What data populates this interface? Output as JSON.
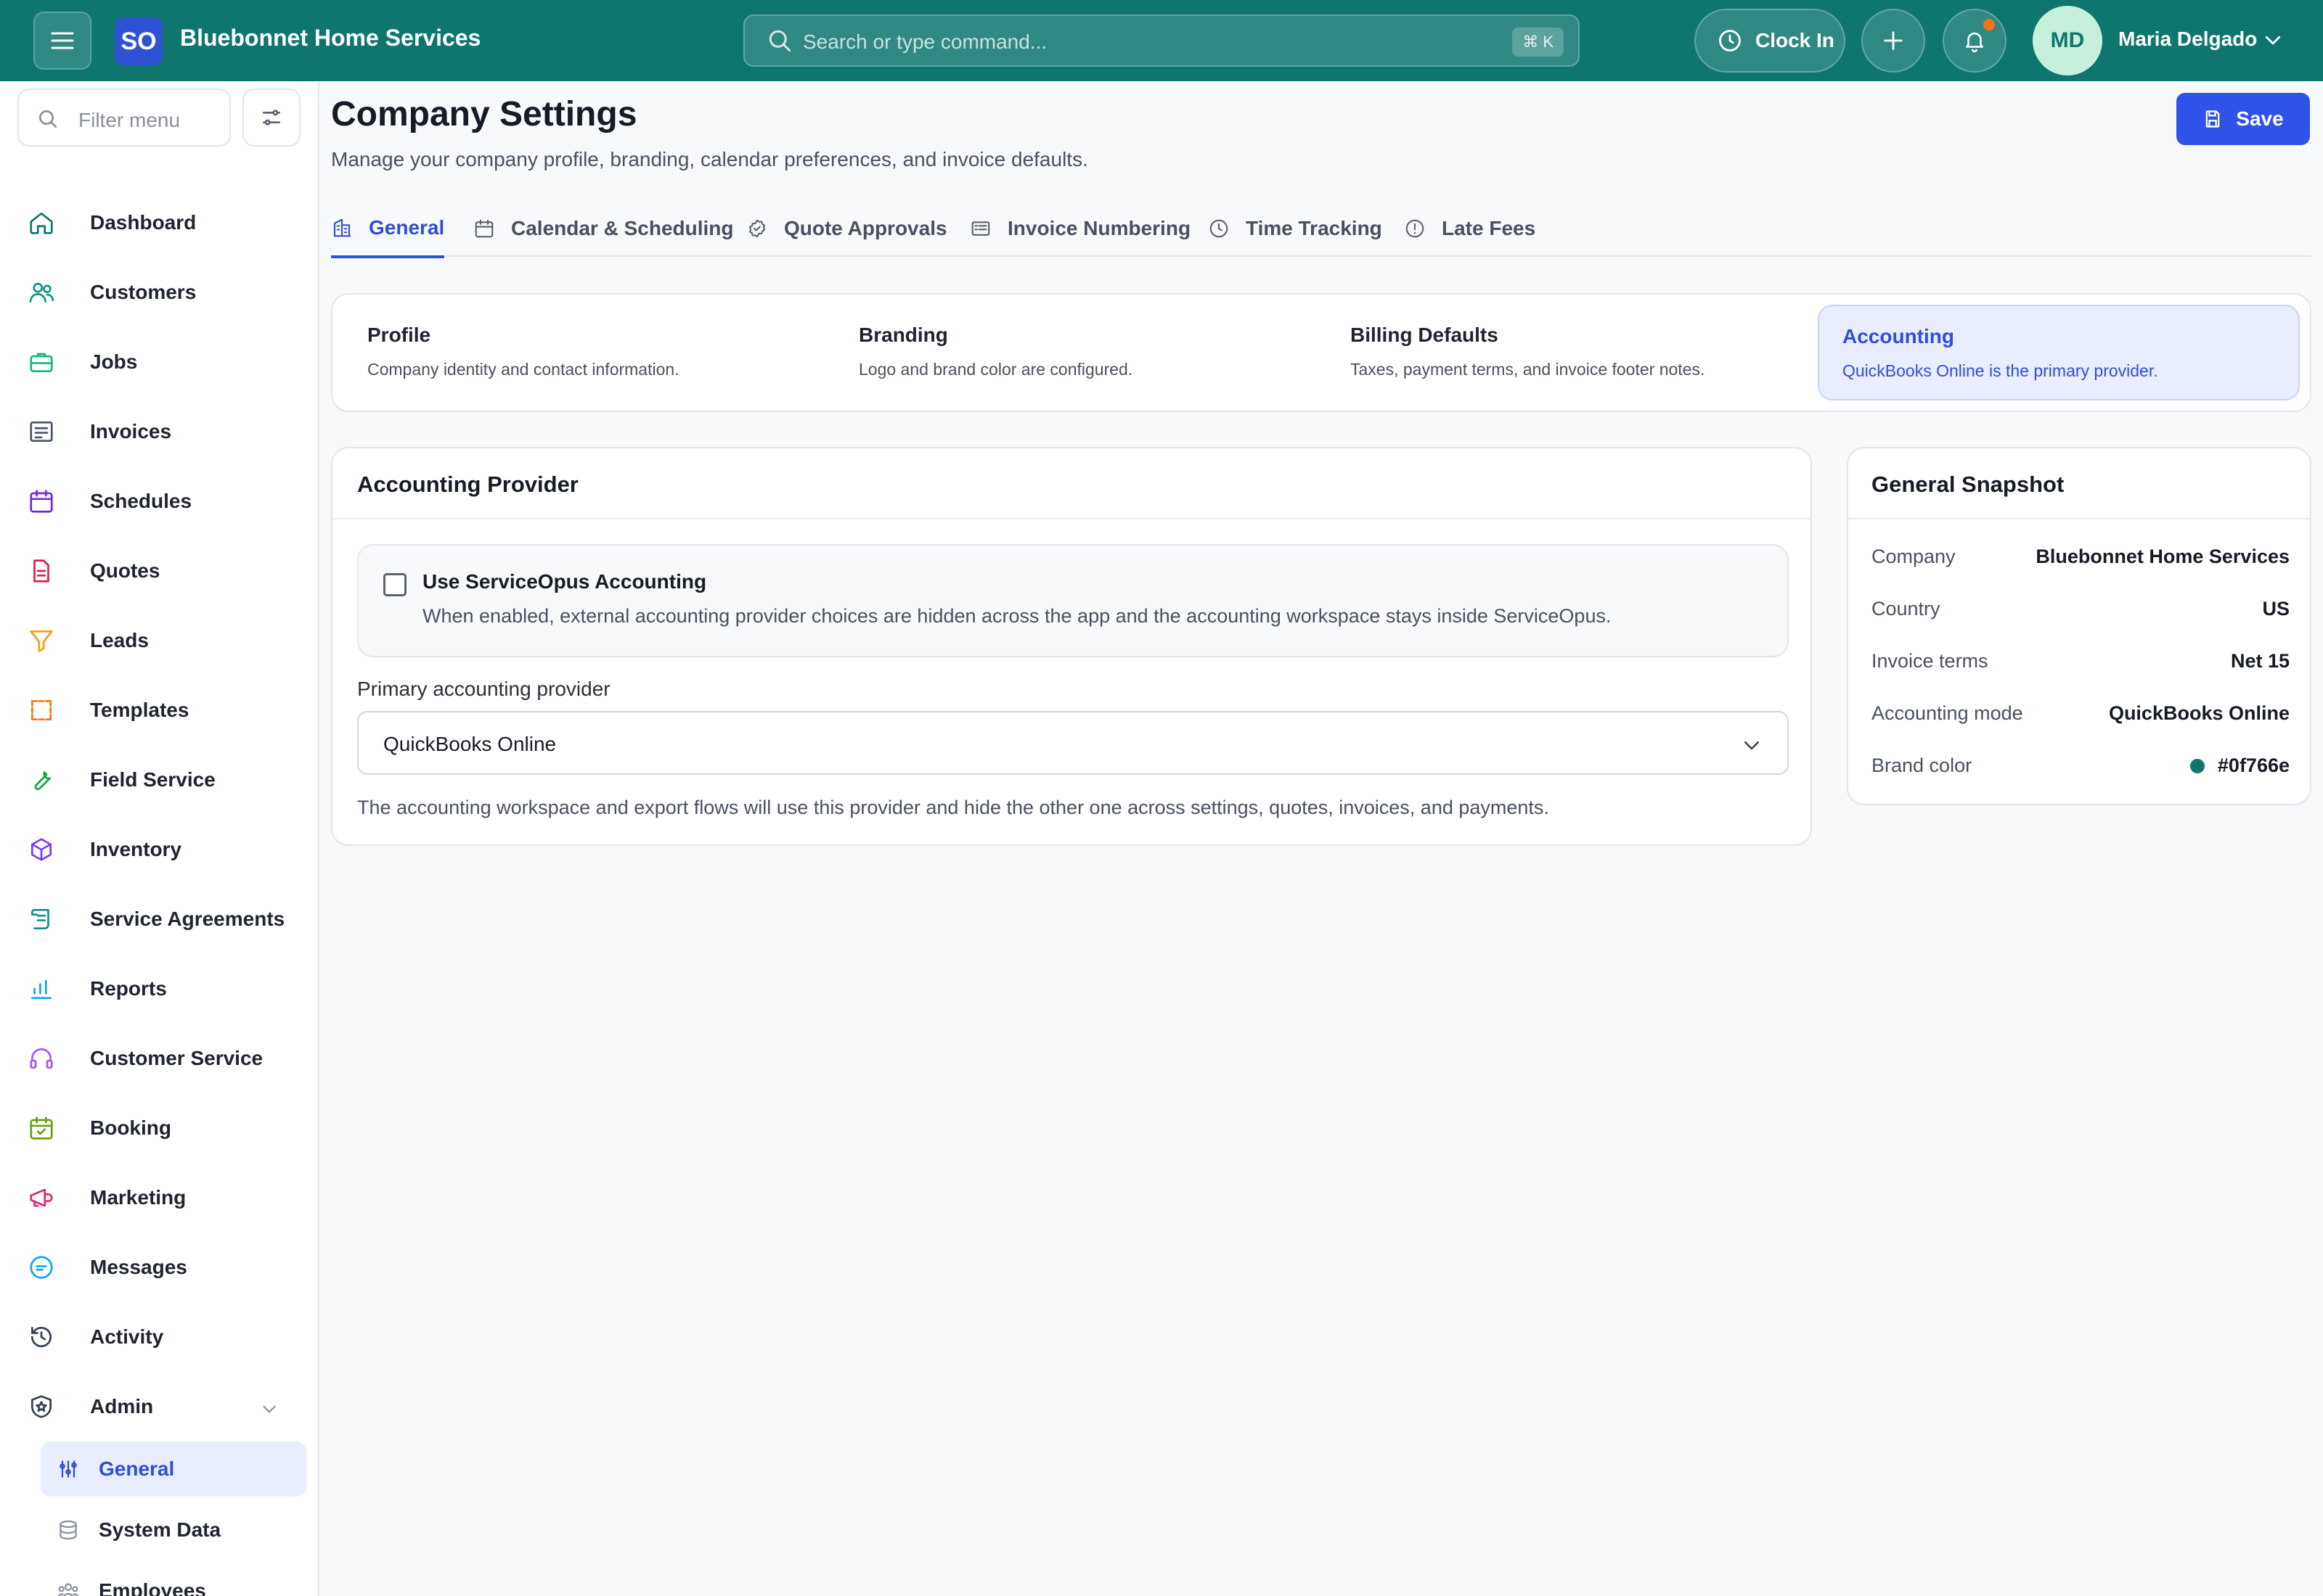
{
  "header": {
    "logo_text": "SO",
    "brand_name": "Bluebonnet Home Services",
    "search_placeholder": "Search or type command...",
    "search_shortcut": "⌘ K",
    "clock_in_label": "Clock In",
    "user_initials": "MD",
    "user_name": "Maria Delgado"
  },
  "sidebar": {
    "filter_placeholder": "Filter menu",
    "items": [
      {
        "label": "Dashboard",
        "icon": "home-icon",
        "color": "#0f766e"
      },
      {
        "label": "Customers",
        "icon": "users-icon",
        "color": "#0d9488"
      },
      {
        "label": "Jobs",
        "icon": "briefcase-icon",
        "color": "#10b981"
      },
      {
        "label": "Invoices",
        "icon": "receipt-icon",
        "color": "#475569"
      },
      {
        "label": "Schedules",
        "icon": "calendar-icon",
        "color": "#6d28d9"
      },
      {
        "label": "Quotes",
        "icon": "file-icon",
        "color": "#e11d48"
      },
      {
        "label": "Leads",
        "icon": "funnel-icon",
        "color": "#f59e0b"
      },
      {
        "label": "Templates",
        "icon": "template-icon",
        "color": "#f97316"
      },
      {
        "label": "Field Service",
        "icon": "wrench-icon",
        "color": "#16a34a"
      },
      {
        "label": "Inventory",
        "icon": "box-icon",
        "color": "#7c3aed"
      },
      {
        "label": "Service Agreements",
        "icon": "scroll-icon",
        "color": "#0d9488"
      },
      {
        "label": "Reports",
        "icon": "bar-chart-icon",
        "color": "#0ea5e9"
      },
      {
        "label": "Customer Service",
        "icon": "headset-icon",
        "color": "#a855f7"
      },
      {
        "label": "Booking",
        "icon": "calendar-check-icon",
        "color": "#65a30d"
      },
      {
        "label": "Marketing",
        "icon": "megaphone-icon",
        "color": "#db2777"
      },
      {
        "label": "Messages",
        "icon": "message-icon",
        "color": "#0ea5e9"
      },
      {
        "label": "Activity",
        "icon": "history-icon",
        "color": "#334155"
      },
      {
        "label": "Admin",
        "icon": "shield-icon",
        "color": "#334155"
      }
    ],
    "admin_sub": [
      {
        "label": "General",
        "icon": "sliders-icon",
        "active": true
      },
      {
        "label": "System Data",
        "icon": "database-icon",
        "active": false
      },
      {
        "label": "Employees",
        "icon": "team-icon",
        "active": false
      }
    ]
  },
  "page": {
    "title": "Company Settings",
    "subtitle": "Manage your company profile, branding, calendar preferences, and invoice defaults.",
    "save_label": "Save"
  },
  "tabs": [
    {
      "label": "General",
      "icon": "building-icon",
      "active": true
    },
    {
      "label": "Calendar & Scheduling",
      "icon": "calendar-icon",
      "active": false
    },
    {
      "label": "Quote Approvals",
      "icon": "badge-check-icon",
      "active": false
    },
    {
      "label": "Invoice Numbering",
      "icon": "list-icon",
      "active": false
    },
    {
      "label": "Time Tracking",
      "icon": "clock-icon",
      "active": false
    },
    {
      "label": "Late Fees",
      "icon": "alert-circle-icon",
      "active": false
    }
  ],
  "sections": [
    {
      "title": "Profile",
      "description": "Company identity and contact information.",
      "active": false
    },
    {
      "title": "Branding",
      "description": "Logo and brand color are configured.",
      "active": false
    },
    {
      "title": "Billing Defaults",
      "description": "Taxes, payment terms, and invoice footer notes.",
      "active": false
    },
    {
      "title": "Accounting",
      "description": "QuickBooks Online is the primary provider.",
      "active": true
    }
  ],
  "accounting": {
    "title": "Accounting Provider",
    "use_internal_label": "Use ServiceOpus Accounting",
    "use_internal_checked": false,
    "use_internal_description": "When enabled, external accounting provider choices are hidden across the app and the accounting workspace stays inside ServiceOpus.",
    "provider_label": "Primary accounting provider",
    "provider_value": "QuickBooks Online",
    "provider_help": "The accounting workspace and export flows will use this provider and hide the other one across settings, quotes, invoices, and payments."
  },
  "snapshot": {
    "title": "General Snapshot",
    "rows": [
      {
        "key": "Company",
        "value": "Bluebonnet Home Services"
      },
      {
        "key": "Country",
        "value": "US"
      },
      {
        "key": "Invoice terms",
        "value": "Net 15"
      },
      {
        "key": "Accounting mode",
        "value": "QuickBooks Online"
      },
      {
        "key": "Brand color",
        "value": "#0f766e"
      }
    ],
    "brand_color": "#0f766e"
  }
}
